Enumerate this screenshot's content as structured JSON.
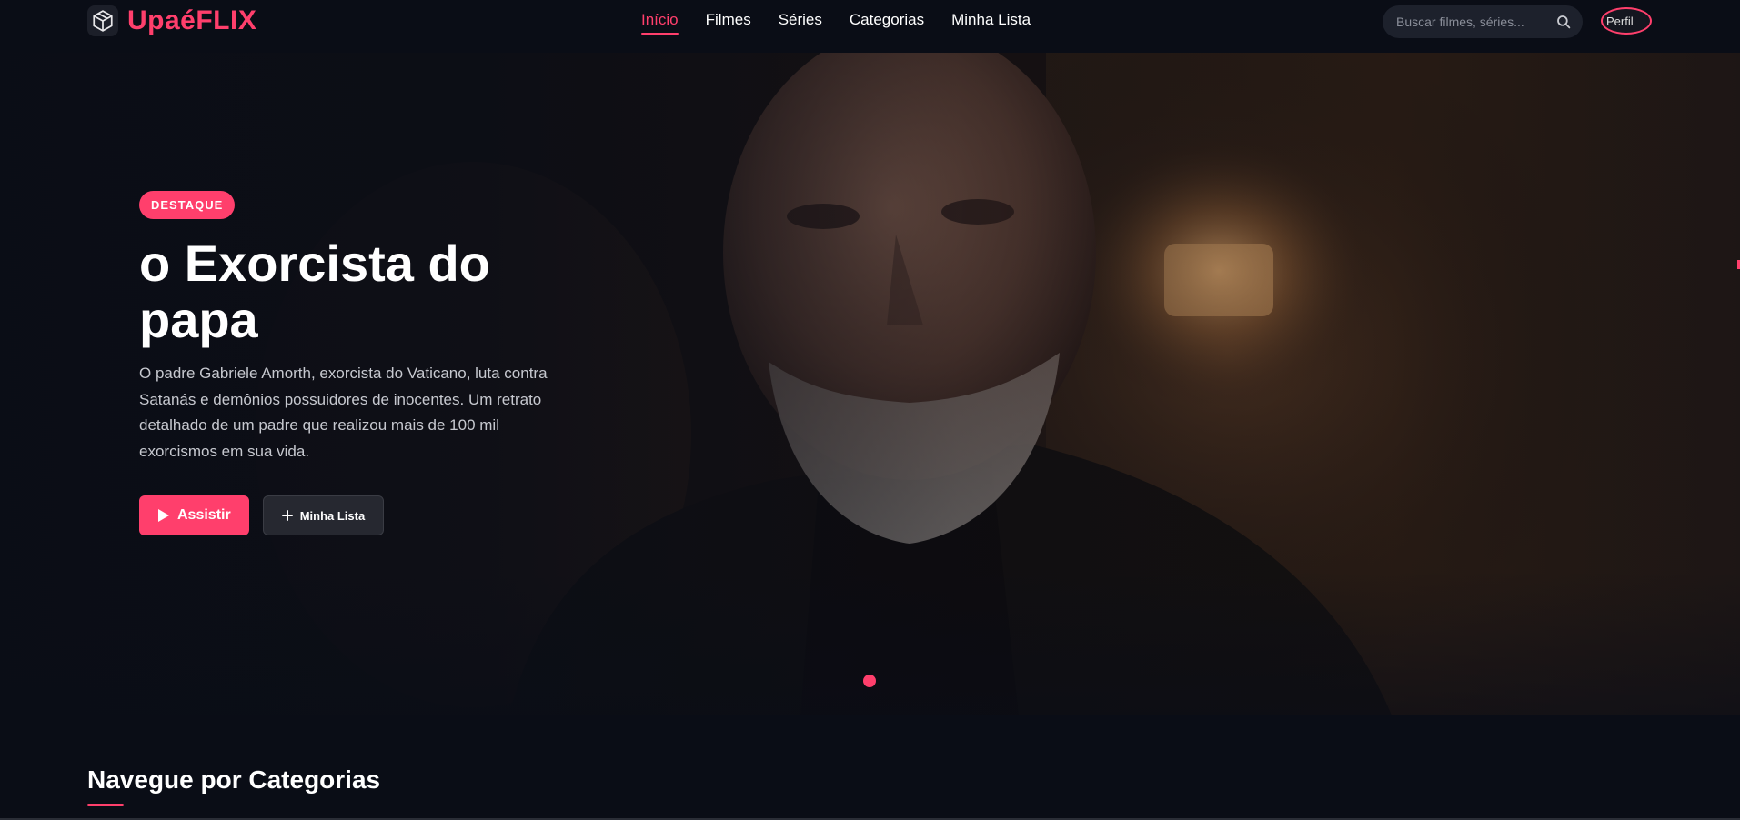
{
  "header": {
    "logo_text": "UpaéFLIX",
    "nav": [
      {
        "label": "Início",
        "active": true
      },
      {
        "label": "Filmes",
        "active": false
      },
      {
        "label": "Séries",
        "active": false
      },
      {
        "label": "Categorias",
        "active": false
      },
      {
        "label": "Minha Lista",
        "active": false
      }
    ],
    "search_placeholder": "Buscar filmes, séries...",
    "avatar_alt": "Perfil"
  },
  "hero": {
    "badge": "DESTAQUE",
    "title": "o Exorcista do papa",
    "description": "O padre Gabriele Amorth, exorcista do Vaticano, luta contra Satanás e demônios possuidores de inocentes. Um retrato detalhado de um padre que realizou mais de 100 mil exorcismos em sua vida.",
    "watch_label": "Assistir",
    "list_label": "Minha Lista"
  },
  "categories_section": {
    "title": "Navegue por Categorias"
  },
  "colors": {
    "accent": "#ff3f6c",
    "background": "#0a0d16"
  },
  "icons": [
    "cube-logo-icon",
    "search-icon",
    "play-icon",
    "plus-icon"
  ]
}
